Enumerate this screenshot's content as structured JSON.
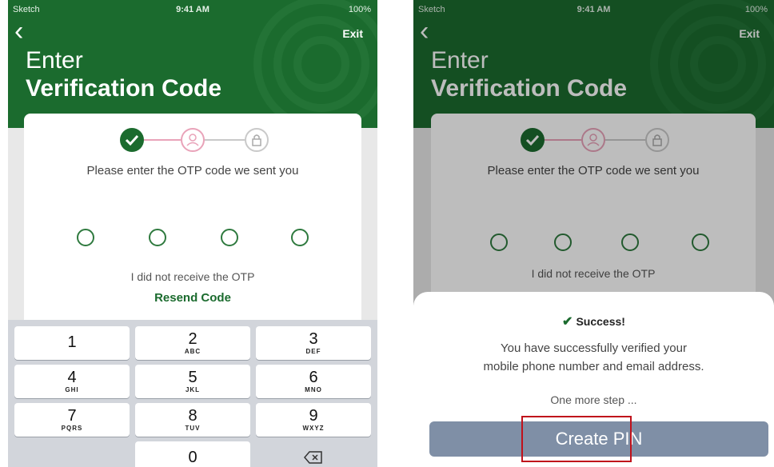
{
  "status_bar": {
    "carrier": "Sketch",
    "time": "9:41 AM",
    "battery": "100%"
  },
  "header": {
    "back_icon": "chevron-left-icon",
    "exit_label": "Exit",
    "title_line1": "Enter",
    "title_line2": "Verification Code"
  },
  "stepper": {
    "steps": [
      "check-icon",
      "user-icon",
      "lock-icon"
    ]
  },
  "otp": {
    "prompt": "Please enter the OTP code we sent you",
    "not_received": "I did not receive the OTP",
    "resend_label": "Resend Code"
  },
  "keypad": {
    "keys": [
      {
        "digit": "1",
        "letters": ""
      },
      {
        "digit": "2",
        "letters": "ABC"
      },
      {
        "digit": "3",
        "letters": "DEF"
      },
      {
        "digit": "4",
        "letters": "GHI"
      },
      {
        "digit": "5",
        "letters": "JKL"
      },
      {
        "digit": "6",
        "letters": "MNO"
      },
      {
        "digit": "7",
        "letters": "PQRS"
      },
      {
        "digit": "8",
        "letters": "TUV"
      },
      {
        "digit": "9",
        "letters": "WXYZ"
      },
      {
        "digit": "0",
        "letters": ""
      }
    ],
    "delete_icon": "backspace-icon"
  },
  "success_sheet": {
    "title": "Success!",
    "message_line1": "You have successfully verified your",
    "message_line2": "mobile phone number and email address.",
    "step_note": "One more step ...",
    "button_label": "Create PIN"
  },
  "colors": {
    "brand_green": "#1b6b2e",
    "button_gray": "#7f8fa6",
    "highlight_red": "#c0111b",
    "step_pink": "#e9a3b9"
  }
}
